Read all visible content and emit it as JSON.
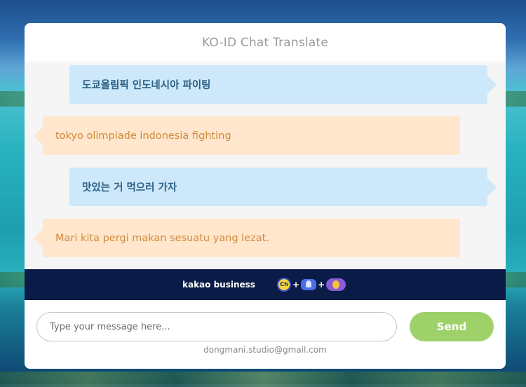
{
  "header": {
    "title": "KO-ID Chat Translate"
  },
  "messages": [
    {
      "side": "out",
      "text": "도쿄올림픽 인도네시아 파이팅"
    },
    {
      "side": "in",
      "text": "tokyo olimpiade indonesia fighting"
    },
    {
      "side": "out",
      "text": "맛있는 거 먹으러 가자"
    },
    {
      "side": "in",
      "text": "Mari kita pergi makan sesuatu yang lezat."
    }
  ],
  "banner": {
    "brand": "kakao business",
    "icons": [
      "kakao-channel-icon",
      "rocket-icon",
      "person-icon"
    ],
    "icon_ch_label": "Ch",
    "plus": "+"
  },
  "composer": {
    "placeholder": "Type your message here...",
    "send_label": "Send"
  },
  "footer": {
    "email": "dongmani.studio@gmail.com"
  },
  "colors": {
    "outgoing_bubble": "#cde8fa",
    "incoming_bubble": "#ffe6cc",
    "send_button": "#9ed16a",
    "banner": "#0b1b47"
  }
}
